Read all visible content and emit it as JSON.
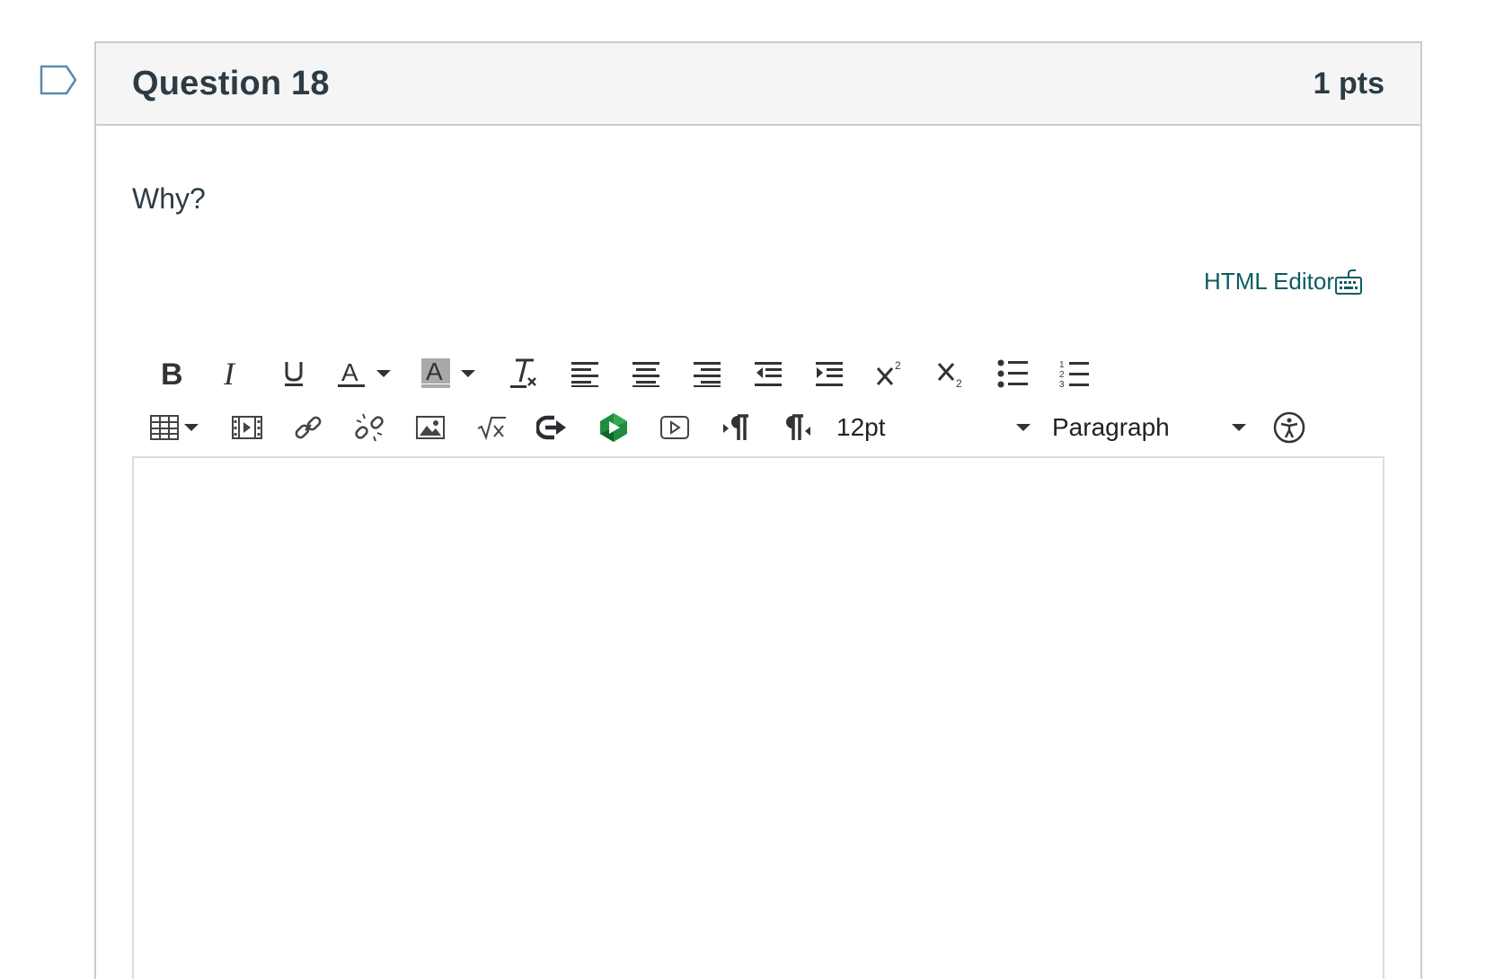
{
  "question": {
    "title": "Question 18",
    "points": "1 pts",
    "text": "Why?"
  },
  "editor": {
    "html_editor_label": "HTML Editor",
    "font_size": "12pt",
    "block_format": "Paragraph",
    "content": ""
  },
  "icons": {
    "flag": "flag-question-icon",
    "keyboard": "keyboard-icon",
    "row1": [
      "bold-icon",
      "italic-icon",
      "underline-icon",
      "text-color-icon",
      "background-color-icon",
      "clear-formatting-icon",
      "align-left-icon",
      "align-center-icon",
      "align-right-icon",
      "outdent-icon",
      "indent-icon",
      "superscript-icon",
      "subscript-icon",
      "bullet-list-icon",
      "numbered-list-icon"
    ],
    "row2": [
      "table-icon",
      "media-icon",
      "link-icon",
      "unlink-icon",
      "image-icon",
      "equation-icon",
      "lti-tool-icon",
      "google-drive-icon",
      "video-icon",
      "ltr-paragraph-icon",
      "rtl-paragraph-icon",
      "accessibility-icon"
    ]
  },
  "colors": {
    "link": "#0b5d63",
    "header_bg": "#f5f5f5",
    "border": "#c7cdd1",
    "text": "#2d3b45",
    "drive_green": "#1e8e3e"
  }
}
